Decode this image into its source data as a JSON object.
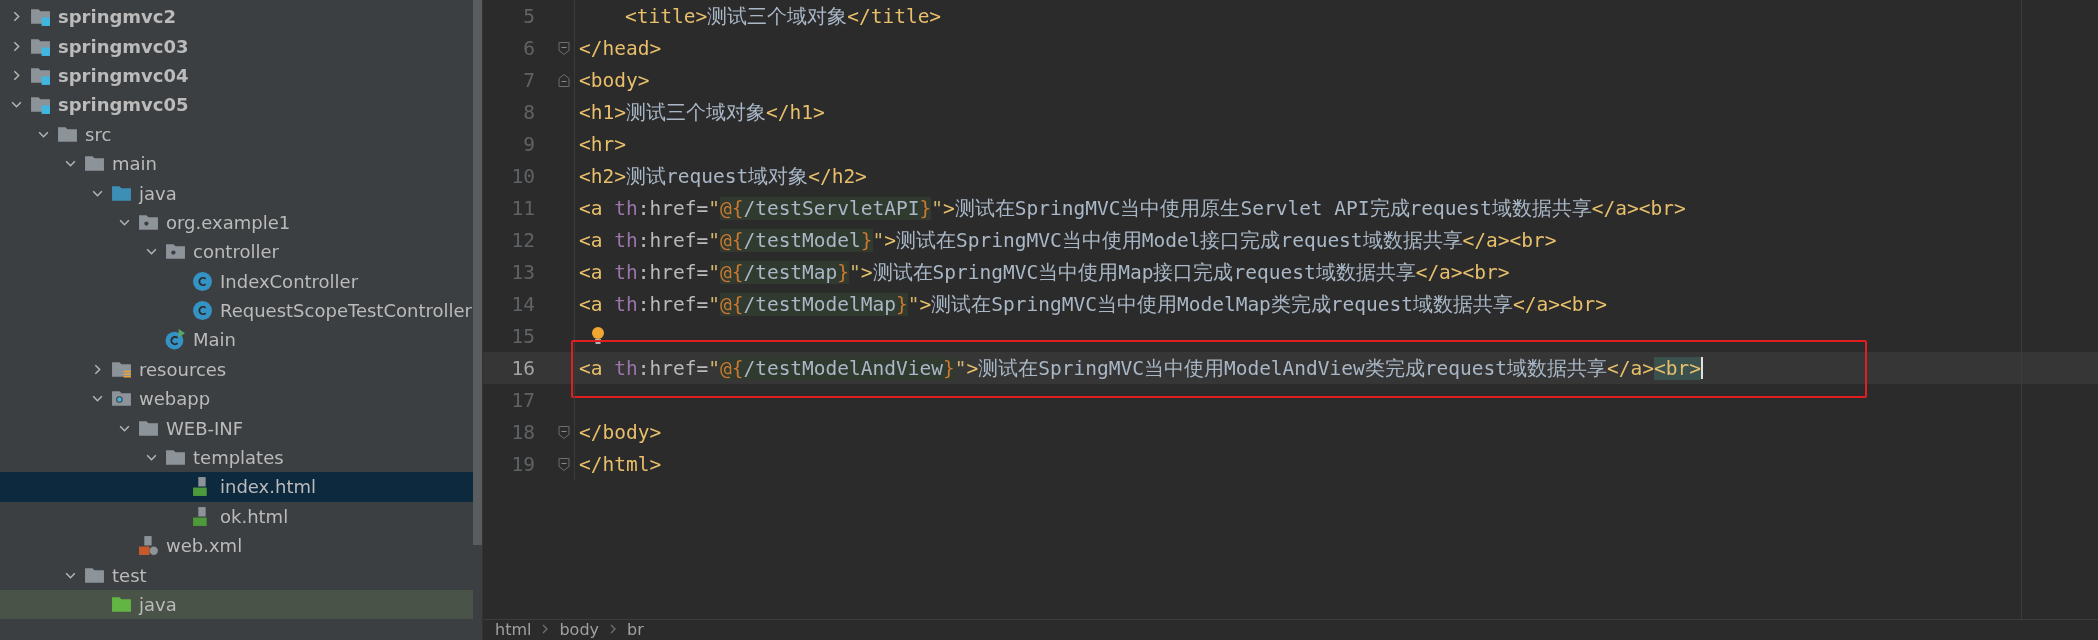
{
  "project_tree": [
    {
      "label": "springmvc2",
      "kind": "module",
      "expanded": false,
      "selected": false,
      "hovered": false
    },
    {
      "label": "springmvc03",
      "kind": "module",
      "expanded": false,
      "selected": false,
      "hovered": false
    },
    {
      "label": "springmvc04",
      "kind": "module",
      "expanded": false,
      "selected": false,
      "hovered": false
    },
    {
      "label": "springmvc05",
      "kind": "module",
      "expanded": true,
      "selected": false,
      "hovered": false,
      "children": [
        {
          "label": "src",
          "kind": "folder",
          "expanded": true,
          "selected": false,
          "hovered": false,
          "children": [
            {
              "label": "main",
              "kind": "folder",
              "expanded": true,
              "selected": false,
              "hovered": false,
              "children": [
                {
                  "label": "java",
                  "kind": "source-folder",
                  "expanded": true,
                  "selected": false,
                  "hovered": false,
                  "children": [
                    {
                      "label": "org.example1",
                      "kind": "package",
                      "expanded": true,
                      "selected": false,
                      "hovered": false,
                      "children": [
                        {
                          "label": "controller",
                          "kind": "package",
                          "expanded": true,
                          "selected": false,
                          "hovered": false,
                          "children": [
                            {
                              "label": "IndexController",
                              "kind": "class",
                              "selected": false,
                              "hovered": false
                            },
                            {
                              "label": "RequestScopeTestController",
                              "kind": "class",
                              "selected": false,
                              "hovered": false
                            }
                          ]
                        },
                        {
                          "label": "Main",
                          "kind": "main-class",
                          "selected": false,
                          "hovered": false
                        }
                      ]
                    }
                  ]
                },
                {
                  "label": "resources",
                  "kind": "resources",
                  "expanded": false,
                  "selected": false,
                  "hovered": false
                },
                {
                  "label": "webapp",
                  "kind": "web-folder",
                  "expanded": true,
                  "selected": false,
                  "hovered": false,
                  "children": [
                    {
                      "label": "WEB-INF",
                      "kind": "folder",
                      "expanded": true,
                      "selected": false,
                      "hovered": false,
                      "children": [
                        {
                          "label": "templates",
                          "kind": "folder",
                          "expanded": true,
                          "selected": false,
                          "hovered": false,
                          "children": [
                            {
                              "label": "index.html",
                              "kind": "html",
                              "selected": true,
                              "hovered": false
                            },
                            {
                              "label": "ok.html",
                              "kind": "html",
                              "selected": false,
                              "hovered": false
                            }
                          ]
                        }
                      ]
                    },
                    {
                      "label": "web.xml",
                      "kind": "xml",
                      "selected": false,
                      "hovered": false
                    }
                  ]
                }
              ]
            },
            {
              "label": "test",
              "kind": "folder",
              "expanded": true,
              "selected": false,
              "hovered": false,
              "children": [
                {
                  "label": "java",
                  "kind": "test-folder",
                  "selected": false,
                  "hovered": true
                }
              ]
            }
          ]
        }
      ]
    }
  ],
  "editor": {
    "lines": [
      {
        "number": "5",
        "indented": true,
        "tokens": [
          {
            "kind": "tag",
            "text": "<title>"
          },
          {
            "kind": "text",
            "text": "测试三个域对象"
          },
          {
            "kind": "tag",
            "text": "</title>"
          }
        ]
      },
      {
        "number": "6",
        "fold_end": true,
        "tokens": [
          {
            "kind": "tag",
            "text": "</head>"
          }
        ]
      },
      {
        "number": "7",
        "fold_start": true,
        "tokens": [
          {
            "kind": "tag",
            "text": "<body>"
          }
        ]
      },
      {
        "number": "8",
        "tokens": [
          {
            "kind": "tag",
            "text": "<h1>"
          },
          {
            "kind": "text",
            "text": "测试三个域对象"
          },
          {
            "kind": "tag",
            "text": "</h1>"
          }
        ]
      },
      {
        "number": "9",
        "tokens": [
          {
            "kind": "tag",
            "text": "<hr>"
          }
        ]
      },
      {
        "number": "10",
        "tokens": [
          {
            "kind": "tag",
            "text": "<h2>"
          },
          {
            "kind": "text",
            "text": "测试request域对象"
          },
          {
            "kind": "tag",
            "text": "</h2>"
          }
        ]
      },
      {
        "number": "11",
        "tokens": [
          {
            "kind": "tag",
            "text": "<a "
          },
          {
            "kind": "ns",
            "text": "th"
          },
          {
            "kind": "attr",
            "text": ":href="
          },
          {
            "kind": "quote",
            "text": "\""
          },
          {
            "kind": "brace",
            "text": "@{"
          },
          {
            "kind": "path",
            "text": "/testServletAPI"
          },
          {
            "kind": "brace",
            "text": "}"
          },
          {
            "kind": "quote",
            "text": "\""
          },
          {
            "kind": "tag",
            "text": ">"
          },
          {
            "kind": "text",
            "text": "测试在SpringMVC当中使用原生Servlet API完成request域数据共享"
          },
          {
            "kind": "tag",
            "text": "</a><br>"
          }
        ]
      },
      {
        "number": "12",
        "tokens": [
          {
            "kind": "tag",
            "text": "<a "
          },
          {
            "kind": "ns",
            "text": "th"
          },
          {
            "kind": "attr",
            "text": ":href="
          },
          {
            "kind": "quote",
            "text": "\""
          },
          {
            "kind": "brace",
            "text": "@{"
          },
          {
            "kind": "path",
            "text": "/testModel"
          },
          {
            "kind": "brace",
            "text": "}"
          },
          {
            "kind": "quote",
            "text": "\""
          },
          {
            "kind": "tag",
            "text": ">"
          },
          {
            "kind": "text",
            "text": "测试在SpringMVC当中使用Model接口完成request域数据共享"
          },
          {
            "kind": "tag",
            "text": "</a><br>"
          }
        ]
      },
      {
        "number": "13",
        "tokens": [
          {
            "kind": "tag",
            "text": "<a "
          },
          {
            "kind": "ns",
            "text": "th"
          },
          {
            "kind": "attr",
            "text": ":href="
          },
          {
            "kind": "quote",
            "text": "\""
          },
          {
            "kind": "brace",
            "text": "@{"
          },
          {
            "kind": "path",
            "text": "/testMap"
          },
          {
            "kind": "brace",
            "text": "}"
          },
          {
            "kind": "quote",
            "text": "\""
          },
          {
            "kind": "tag",
            "text": ">"
          },
          {
            "kind": "text",
            "text": "测试在SpringMVC当中使用Map接口完成request域数据共享"
          },
          {
            "kind": "tag",
            "text": "</a><br>"
          }
        ]
      },
      {
        "number": "14",
        "tokens": [
          {
            "kind": "tag",
            "text": "<a "
          },
          {
            "kind": "ns",
            "text": "th"
          },
          {
            "kind": "attr",
            "text": ":href="
          },
          {
            "kind": "quote",
            "text": "\""
          },
          {
            "kind": "brace",
            "text": "@{"
          },
          {
            "kind": "path",
            "text": "/testModelMap"
          },
          {
            "kind": "brace",
            "text": "}"
          },
          {
            "kind": "quote",
            "text": "\""
          },
          {
            "kind": "tag",
            "text": ">"
          },
          {
            "kind": "text",
            "text": "测试在SpringMVC当中使用ModelMap类完成request域数据共享"
          },
          {
            "kind": "tag",
            "text": "</a><br>"
          }
        ]
      },
      {
        "number": "15",
        "bulb": true
      },
      {
        "number": "16",
        "current": true,
        "annotated": true,
        "cursor": true,
        "tokens": [
          {
            "kind": "tag",
            "text": "<a "
          },
          {
            "kind": "ns",
            "text": "th"
          },
          {
            "kind": "attr",
            "text": ":href="
          },
          {
            "kind": "quote",
            "text": "\""
          },
          {
            "kind": "brace",
            "text": "@{"
          },
          {
            "kind": "path",
            "text": "/testModelAndView"
          },
          {
            "kind": "brace",
            "text": "}"
          },
          {
            "kind": "quote",
            "text": "\""
          },
          {
            "kind": "tag",
            "text": ">"
          },
          {
            "kind": "text",
            "text": "测试在SpringMVC当中使用ModelAndView类完成request域数据共享"
          },
          {
            "kind": "tag",
            "text": "</a>"
          },
          {
            "kind": "matched",
            "text": "<br>"
          }
        ]
      },
      {
        "number": "17"
      },
      {
        "number": "18",
        "fold_end": true,
        "tokens": [
          {
            "kind": "tag",
            "text": "</body>"
          }
        ]
      },
      {
        "number": "19",
        "fold_end": true,
        "tokens": [
          {
            "kind": "tag",
            "text": "</html>"
          }
        ]
      }
    ]
  },
  "breadcrumbs": [
    "html",
    "body",
    "br"
  ]
}
